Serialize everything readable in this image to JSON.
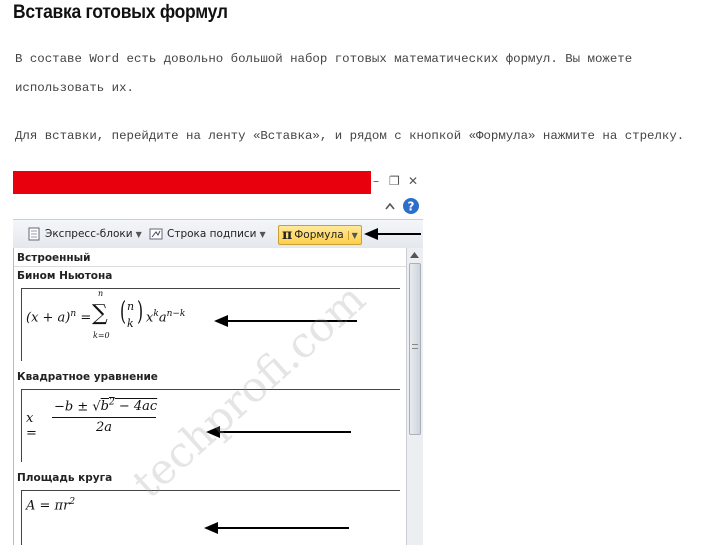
{
  "article": {
    "title": "Вставка готовых формул",
    "para1_line1": "В составе Word есть довольно большой набор готовых математических формул. Вы можете",
    "para1_line2": "использовать их.",
    "para2": "Для вставки, перейдите на ленту «Вставка», и рядом с кнопкой «Формула» нажмите на стрелку."
  },
  "screenshot": {
    "window_controls": {
      "minimize": "–",
      "restore": "❐",
      "close": "✕"
    },
    "ribbon": {
      "express_blocks": "Экспресс-блоки",
      "signature_line": "Строка подписи",
      "formula_symbol": "π",
      "formula": "Формула"
    },
    "gallery": {
      "header": "Встроенный",
      "items": [
        {
          "label": "Бином Ньютона"
        },
        {
          "label": "Квадратное уравнение"
        },
        {
          "label": "Площадь круга"
        }
      ]
    },
    "watermark": "techprofi.com",
    "colors": {
      "title_bar": "#e8000c",
      "formula_button": "#ffd666"
    }
  }
}
